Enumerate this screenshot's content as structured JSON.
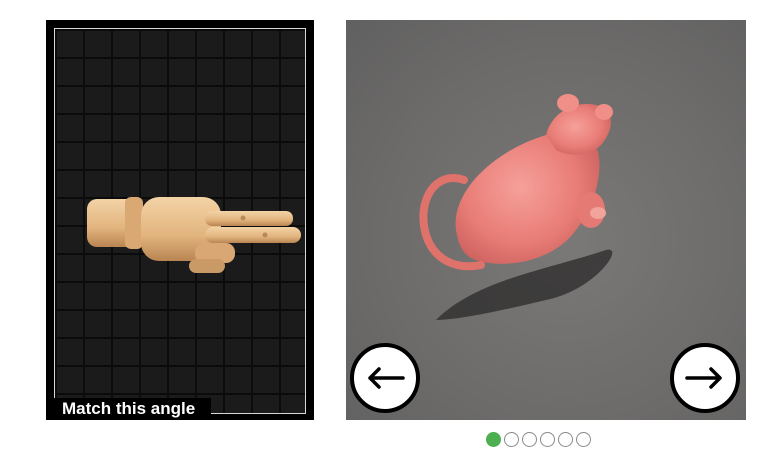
{
  "reference": {
    "label": "Match this angle",
    "image": "wooden-hand-pointing-icon"
  },
  "rotator": {
    "image": "pink-rat-model-icon",
    "prev_icon": "arrow-left-icon",
    "next_icon": "arrow-right-icon"
  },
  "pager": {
    "total": 6,
    "active_index": 0,
    "active_color": "#4caf50"
  }
}
